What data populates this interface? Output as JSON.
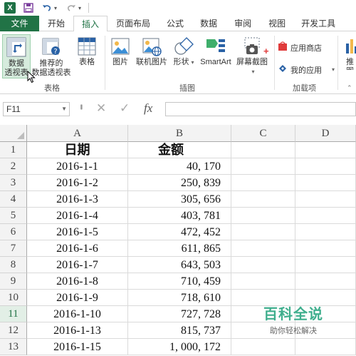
{
  "qat": {
    "app_icon": "X",
    "save_icon": "floppy-save-icon",
    "undo_icon": "undo-icon",
    "redo_icon": "redo-icon"
  },
  "tabs": [
    {
      "label": "文件"
    },
    {
      "label": "开始"
    },
    {
      "label": "插入"
    },
    {
      "label": "页面布局"
    },
    {
      "label": "公式"
    },
    {
      "label": "数据"
    },
    {
      "label": "审阅"
    },
    {
      "label": "视图"
    },
    {
      "label": "开发工具"
    }
  ],
  "ribbon": {
    "pivot_table": "数据\n透视表",
    "pivot_table_l1": "数据",
    "pivot_table_l2": "透视表",
    "recommended_pivot_l1": "推荐的",
    "recommended_pivot_l2": "数据透视表",
    "table": "表格",
    "group_tables": "表格",
    "picture": "图片",
    "online_picture": "联机图片",
    "shapes": "形状",
    "smartart": "SmartArt",
    "screenshot": "屏幕截图",
    "group_illustrations": "插图",
    "app_store": "应用商店",
    "my_apps": "我的应用",
    "group_addins": "加载项",
    "recommended_chart_l1": "推",
    "recommended_chart_l2": "图"
  },
  "formula_bar": {
    "name_box": "F11",
    "cancel_symbol": "✕",
    "enter_symbol": "✓",
    "fx_symbol": "fx",
    "value": ""
  },
  "grid": {
    "columns": [
      "A",
      "B",
      "C",
      "D"
    ],
    "rows": [
      {
        "num": "1",
        "a": "日期",
        "b": "金额",
        "header": true
      },
      {
        "num": "2",
        "a": "2016-1-1",
        "b": "40, 170"
      },
      {
        "num": "3",
        "a": "2016-1-2",
        "b": "250, 839"
      },
      {
        "num": "4",
        "a": "2016-1-3",
        "b": "305, 656"
      },
      {
        "num": "5",
        "a": "2016-1-4",
        "b": "403, 781"
      },
      {
        "num": "6",
        "a": "2016-1-5",
        "b": "472, 452"
      },
      {
        "num": "7",
        "a": "2016-1-6",
        "b": "611, 865"
      },
      {
        "num": "8",
        "a": "2016-1-7",
        "b": "643, 503"
      },
      {
        "num": "9",
        "a": "2016-1-8",
        "b": "710, 459"
      },
      {
        "num": "10",
        "a": "2016-1-9",
        "b": "718, 610"
      },
      {
        "num": "11",
        "a": "2016-1-10",
        "b": "727, 728",
        "selected": true
      },
      {
        "num": "12",
        "a": "2016-1-13",
        "b": "815, 737"
      },
      {
        "num": "13",
        "a": "2016-1-15",
        "b": "1, 000, 172"
      }
    ]
  },
  "watermark": {
    "title": "百科全说",
    "subtitle": "助你轻松解决"
  },
  "colors": {
    "accent": "#217346",
    "watermark": "#3fae8d"
  }
}
